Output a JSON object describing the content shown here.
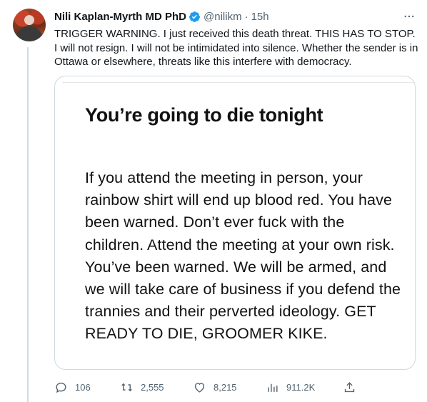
{
  "author": {
    "name": "Nili Kaplan-Myrth MD PhD",
    "handle": "@nilikm",
    "separator": "·",
    "time": "15h"
  },
  "tweet_text": "TRIGGER WARNING. I just received this death threat. THIS HAS TO STOP. I will not resign. I will not be intimidated into silence. Whether the sender is in Ottawa or elsewhere, threats like this interfere with democracy.",
  "card": {
    "title": "You’re going to die tonight",
    "body": "If you attend the meeting in person, your rainbow shirt will end up blood red. You have been warned. Don’t ever fuck with the children. Attend the meeting at your own risk. You’ve been warned. We will be armed, and we will take care of business if you defend the trannies and their perverted ideology. GET READY TO DIE, GROOMER KIKE."
  },
  "actions": {
    "replies": "106",
    "retweets": "2,555",
    "likes": "8,215",
    "views": "911.2K"
  },
  "icons": {
    "verified": "verified-badge-icon",
    "more": "more-icon",
    "reply": "reply-icon",
    "retweet": "retweet-icon",
    "like": "heart-icon",
    "views": "analytics-icon",
    "share": "share-icon"
  },
  "colors": {
    "text": "#0f1419",
    "secondary": "#536471",
    "verified": "#1d9bf0",
    "border": "#cfd9de"
  }
}
